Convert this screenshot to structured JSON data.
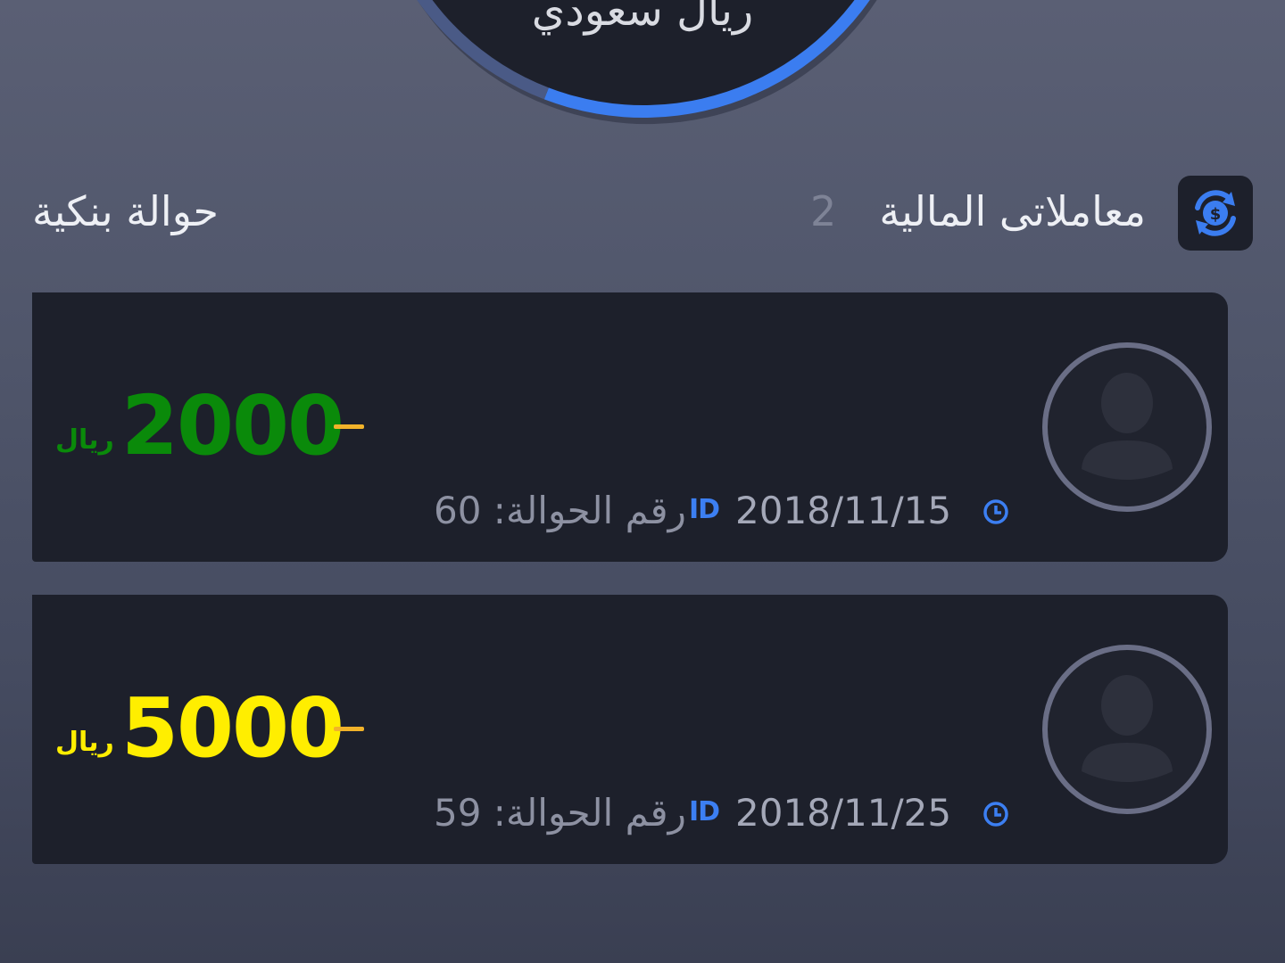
{
  "balance": {
    "currency_label": "ريال سعودي"
  },
  "section": {
    "icon": "currency-exchange-icon",
    "title": "معاملاتى المالية",
    "count": "2",
    "link_label": "حوالة بنكية"
  },
  "transactions": [
    {
      "amount": "2000",
      "currency": "ريال",
      "amount_color": "#0a8a0a",
      "date": "2018/11/15",
      "id_badge": "ID",
      "transfer_number": "رقم الحوالة: 60",
      "avatar_icon": "user-avatar-icon",
      "clock_icon": "clock-icon"
    },
    {
      "amount": "5000",
      "currency": "ريال",
      "amount_color": "#ffee00",
      "date": "2018/11/25",
      "id_badge": "ID",
      "transfer_number": "رقم الحوالة: 59",
      "avatar_icon": "user-avatar-icon",
      "clock_icon": "clock-icon"
    }
  ],
  "colors": {
    "accent_blue": "#3b7df0",
    "dash_orange": "#f2b32a",
    "card_bg": "#1d202b"
  }
}
